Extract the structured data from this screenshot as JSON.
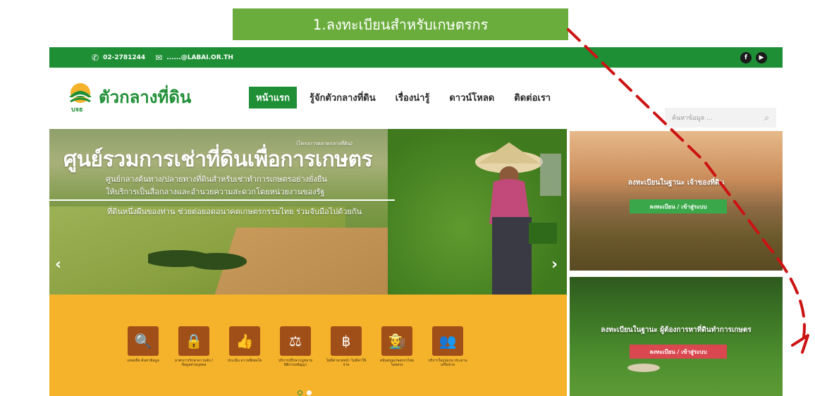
{
  "callout": {
    "text": "1.ลงทะเบียนสำหรับเกษตรกร"
  },
  "topbar": {
    "phone": "02-2781244",
    "email": "......@LABAI.OR.TH",
    "social": [
      {
        "icon": "facebook-icon",
        "glyph": "f"
      },
      {
        "icon": "youtube-icon",
        "glyph": "▶"
      }
    ]
  },
  "logo": {
    "name": "ตัวกลางที่ดิน",
    "abbr": "บจธ"
  },
  "nav": [
    {
      "label": "หน้าแรก",
      "active": true
    },
    {
      "label": "รู้จักตัวกลางที่ดิน",
      "active": false
    },
    {
      "label": "เรื่องน่ารู้",
      "active": false
    },
    {
      "label": "ดาวน์โหลด",
      "active": false
    },
    {
      "label": "ติดต่อเรา",
      "active": false
    }
  ],
  "search": {
    "placeholder": "ค้นหาข้อมูล ..."
  },
  "hero": {
    "tag": "(โครงการตลาดกลางที่ดิน)",
    "title": "ศูนย์รวมการเช่าที่ดินเพื่อการเกษตร",
    "sub1": "ศูนย์กลางต้นทาง/ปลายทางที่ดินสำหรับเช่าทำการเกษตรอย่างยั่งยืน",
    "sub2": "ให้บริการเป็นสื่อกลางและอำนวยความสะดวกโดยหน่วยงานของรัฐ",
    "sub3": "ที่ดินหนึ่งผืนของท่าน ช่วยต่อยอดอนาคตเกษตรกรรมไทย ร่วมจับมือไปด้วยกัน"
  },
  "services": [
    {
      "icon": "search-icon",
      "glyph": "🔍",
      "label": "แหล่งมือ ค้นหาข้อมูล"
    },
    {
      "icon": "lock-icon",
      "glyph": "🔒",
      "label": "มาตรการรักษาความลับ /ข้อมูลส่วนบุคคล"
    },
    {
      "icon": "thumbs-up-icon",
      "glyph": "👍",
      "label": "ประเมิน ความพึงพอใจ"
    },
    {
      "icon": "scales-icon",
      "glyph": "⚖",
      "label": "บริการปรึกษากฎหมาย นิติกรรมสัญญา"
    },
    {
      "icon": "money-hand-icon",
      "glyph": "฿",
      "label": "ไม่มีค่านายหน้า ไม่มีค่าใช้จ่าย"
    },
    {
      "icon": "farmer-icon",
      "glyph": "👨‍🌾",
      "label": "สนับสนุนเกษตรกรไทย โดยตรง"
    },
    {
      "icon": "network-icon",
      "glyph": "👥",
      "label": "บริการในรูปแบบ ประสานเครือข่าย"
    }
  ],
  "slider": {
    "dots": 2,
    "active": 1
  },
  "cards": [
    {
      "title": "ลงทะเบียนในฐานะ เจ้าของที่ดิน",
      "button": "ลงทะเบียน / เข้าสู่ระบบ",
      "button_color": "#3aa84a"
    },
    {
      "title": "ลงทะเบียนในฐานะ ผู้ต้องการหาที่ดินทำการเกษตร",
      "button": "ลงทะเบียน / เข้าสู่ระบบ",
      "button_color": "#d9474f"
    }
  ],
  "colors": {
    "brand_green": "#1f8f36",
    "callout_green": "#6aad3d",
    "services_bg": "#f5b22b",
    "icon_brown": "#a14f18",
    "annotation_red": "#cc1212"
  }
}
